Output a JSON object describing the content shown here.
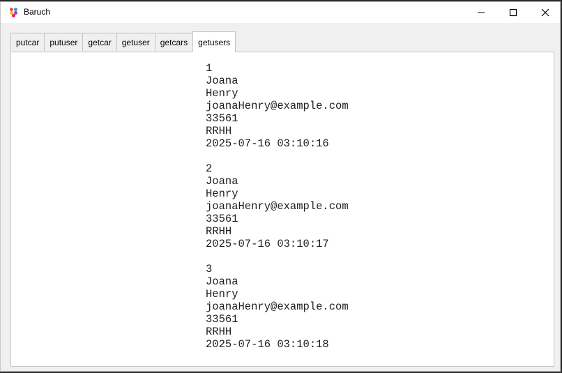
{
  "window": {
    "title": "Baruch"
  },
  "tabs": [
    {
      "label": "putcar"
    },
    {
      "label": "putuser"
    },
    {
      "label": "getcar"
    },
    {
      "label": "getuser"
    },
    {
      "label": "getcars"
    },
    {
      "label": "getusers"
    }
  ],
  "active_tab": "getusers",
  "records": [
    {
      "id": "1",
      "first_name": "Joana",
      "last_name": "Henry",
      "email": "joanaHenry@example.com",
      "code": "33561",
      "department": "RRHH",
      "timestamp": "2025-07-16 03:10:16"
    },
    {
      "id": "2",
      "first_name": "Joana",
      "last_name": "Henry",
      "email": "joanaHenry@example.com",
      "code": "33561",
      "department": "RRHH",
      "timestamp": "2025-07-16 03:10:17"
    },
    {
      "id": "3",
      "first_name": "Joana",
      "last_name": "Henry",
      "email": "joanaHenry@example.com",
      "code": "33561",
      "department": "RRHH",
      "timestamp": "2025-07-16 03:10:18"
    }
  ],
  "icons": {
    "app": "app-dots-icon",
    "minimize": "minimize-icon",
    "maximize": "maximize-icon",
    "close": "close-icon"
  }
}
